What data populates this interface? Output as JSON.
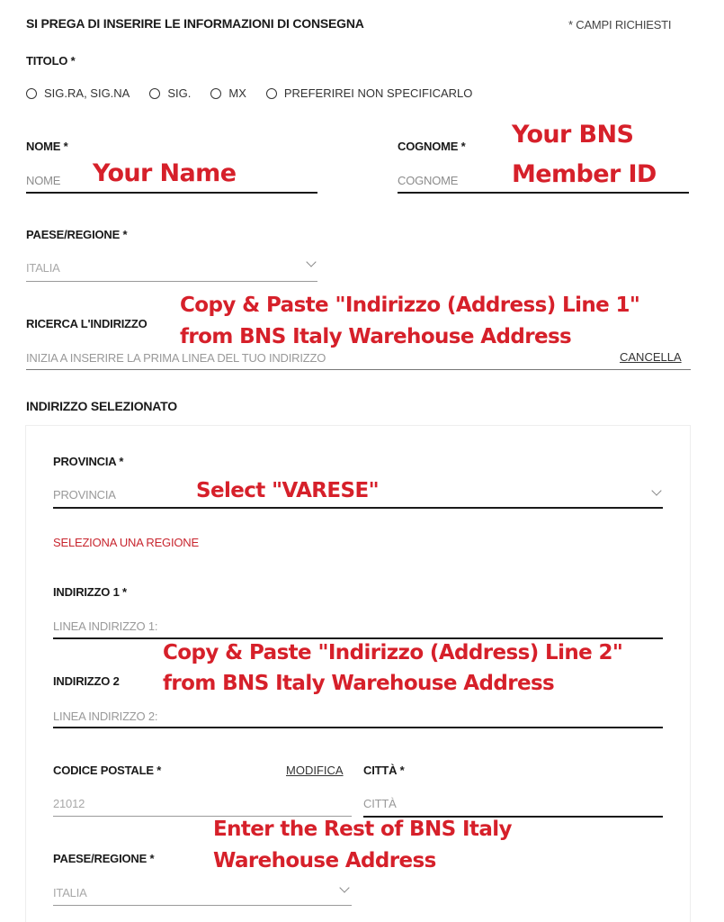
{
  "header": {
    "title": "SI PREGA DI INSERIRE LE INFORMAZIONI DI CONSEGNA",
    "required_note": "* CAMPI RICHIESTI"
  },
  "title_field": {
    "label": "TITOLO *",
    "options": [
      "SIG.RA, SIG.NA",
      "SIG.",
      "MX",
      "PREFERIREI NON SPECIFICARLO"
    ]
  },
  "nome": {
    "label": "NOME *",
    "placeholder": "NOME"
  },
  "cognome": {
    "label": "COGNOME *",
    "placeholder": "COGNOME"
  },
  "paese": {
    "label": "PAESE/REGIONE *",
    "value": "ITALIA"
  },
  "ricerca": {
    "label": "RICERCA L'INDIRIZZO",
    "placeholder": "INIZIA A INSERIRE LA PRIMA LINEA DEL TUO INDIRIZZO",
    "cancel": "CANCELLA"
  },
  "selected_address": {
    "heading": "INDIRIZZO SELEZIONATO",
    "provincia": {
      "label": "PROVINCIA *",
      "placeholder": "PROVINCIA",
      "error": "SELEZIONA UNA REGIONE"
    },
    "indirizzo1": {
      "label": "INDIRIZZO 1 *",
      "placeholder": "LINEA INDIRIZZO 1:"
    },
    "indirizzo2": {
      "label": "INDIRIZZO 2",
      "placeholder": "LINEA INDIRIZZO 2:"
    },
    "cap": {
      "label": "CODICE POSTALE *",
      "value": "21012",
      "edit": "MODIFICA"
    },
    "citta": {
      "label": "CITTÀ *",
      "placeholder": "CITTÀ"
    },
    "paese": {
      "label": "PAESE/REGIONE *",
      "value": "ITALIA"
    }
  },
  "annotations": {
    "name": "Your Name",
    "member_id_1": "Your BNS",
    "member_id_2": "Member ID",
    "line1_a": "Copy & Paste \"Indirizzo (Address) Line 1\"",
    "line1_b": "from BNS Italy Warehouse Address",
    "provincia": "Select \"VARESE\"",
    "line2_a": "Copy & Paste \"Indirizzo (Address) Line 2\"",
    "line2_b": "from BNS Italy Warehouse Address",
    "rest_a": "Enter the Rest of BNS Italy",
    "rest_b": "Warehouse Address"
  },
  "colors": {
    "annotation": "#d6202a",
    "error": "#c8262f"
  }
}
